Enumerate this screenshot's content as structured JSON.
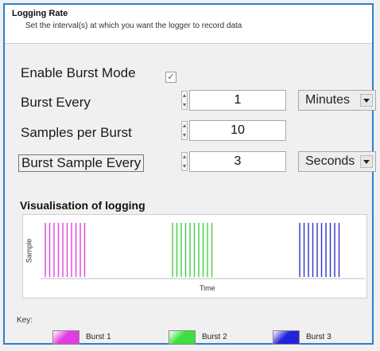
{
  "panel": {
    "title": "Logging Rate",
    "subtitle": "Set the interval(s) at which you want the logger to record data"
  },
  "form": {
    "enable_burst_label": "Enable Burst Mode",
    "enable_burst_checked": true,
    "burst_every_label": "Burst Every",
    "burst_every_value": "1",
    "burst_every_unit": "Minutes",
    "samples_per_burst_label": "Samples per Burst",
    "samples_per_burst_value": "10",
    "burst_sample_every_label": "Burst Sample Every",
    "burst_sample_every_value": "3",
    "burst_sample_every_unit": "Seconds"
  },
  "visualisation": {
    "title": "Visualisation of logging",
    "ylabel": "Sample",
    "xlabel": "Time",
    "bursts": [
      {
        "color": "#e040e0",
        "lines": 10
      },
      {
        "color": "#40d040",
        "lines": 10
      },
      {
        "color": "#3030d0",
        "lines": 10
      }
    ]
  },
  "key": {
    "label": "Key:",
    "items": [
      {
        "label": "Burst 1",
        "color": "#e43be4"
      },
      {
        "label": "Burst 2",
        "color": "#3ee03e"
      },
      {
        "label": "Burst 3",
        "color": "#2323d8"
      }
    ]
  }
}
